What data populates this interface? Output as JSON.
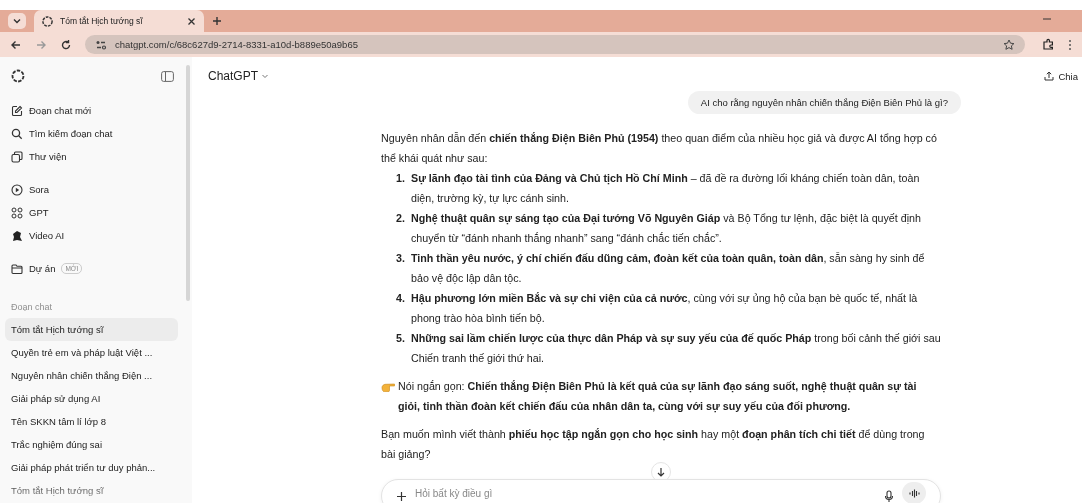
{
  "browser": {
    "tab": {
      "title": "Tóm tắt Hịch tướng sĩ",
      "selected": true
    },
    "url": "chatgpt.com/c/68c627d9-2714-8331-a10d-b889e50a9b65"
  },
  "sidebar": {
    "nav": [
      {
        "kind": "edit",
        "label": "Đoạn chat mới"
      },
      {
        "kind": "search",
        "label": "Tìm kiếm đoạn chat"
      },
      {
        "kind": "library",
        "label": "Thư viện"
      }
    ],
    "apps": [
      {
        "kind": "play",
        "label": "Sora"
      },
      {
        "kind": "grid",
        "label": "GPT"
      },
      {
        "kind": "video",
        "label": "Video AI"
      }
    ],
    "projects": {
      "label": "Dự án",
      "badge": "MỚI"
    },
    "section_title": "Đoạn chat",
    "chats": [
      {
        "title": "Tóm tắt Hịch tướng sĩ",
        "selected": true
      },
      {
        "title": "Quyền trẻ em và pháp luật Việt ...",
        "selected": false
      },
      {
        "title": "Nguyên nhân chiến thắng Điện ...",
        "selected": false
      },
      {
        "title": "Giải pháp sử dụng AI",
        "selected": false
      },
      {
        "title": "Tên SKKN tâm lí lớp 8",
        "selected": false
      },
      {
        "title": "Trắc nghiệm đúng sai",
        "selected": false
      },
      {
        "title": "Giải pháp phát triển tư duy phản...",
        "selected": false
      },
      {
        "title": "Tóm tắt Hịch tướng sĩ",
        "selected": false
      }
    ]
  },
  "header": {
    "model": "ChatGPT",
    "share": "Chia"
  },
  "conversation": {
    "user_message": "AI cho rằng nguyên nhân chiến thắng Điện Biên Phủ là gì?",
    "intro": "Nguyên nhân dẫn đến **chiến thắng Điện Biên Phủ (1954)** theo quan điểm của nhiều học giả và được AI tổng hợp có thể khái quát như sau:",
    "list": [
      {
        "number": "1.",
        "text": "**Sự lãnh đạo tài tình của Đảng và Chủ tịch Hồ Chí Minh** – đã đề ra đường lối kháng chiến toàn dân, toàn diện, trường kỳ, tự lực cánh sinh."
      },
      {
        "number": "2.",
        "text": "**Nghệ thuật quân sự sáng tạo của Đại tướng Võ Nguyên Giáp** và Bộ Tổng tư lệnh, đặc biệt là quyết định chuyển từ “đánh nhanh thắng nhanh” sang “đánh chắc tiến chắc”."
      },
      {
        "number": "3.",
        "text": "**Tinh thần yêu nước, ý chí chiến đấu dũng cảm, đoàn kết của toàn quân, toàn dân**, sẵn sàng hy sinh để bảo vệ độc lập dân tộc."
      },
      {
        "number": "4.",
        "text": "**Hậu phương lớn miền Bắc và sự chi viện của cả nước**, cùng với sự ủng hộ của bạn bè quốc tế, nhất là phong trào hòa bình tiến bộ."
      },
      {
        "number": "5.",
        "text": "**Những sai lầm chiến lược của thực dân Pháp và sự suy yếu của đế quốc Pháp** trong bối cảnh thế giới sau Chiến tranh thế giới thứ hai."
      }
    ],
    "summary": "Nói ngắn gọn: **Chiến thắng Điện Biên Phủ là kết quả của sự lãnh đạo sáng suốt, nghệ thuật quân sự tài giỏi, tinh thần đoàn kết chiến đấu của nhân dân ta, cùng với sự suy yếu của đối phương.**",
    "closing": "Bạn muốn mình viết thành **phiếu học tập ngắn gọn cho học sinh** hay một **đoạn phân tích chi tiết** để dùng trong bài giảng?"
  },
  "composer": {
    "placeholder": "Hỏi bất kỳ điều gì"
  }
}
